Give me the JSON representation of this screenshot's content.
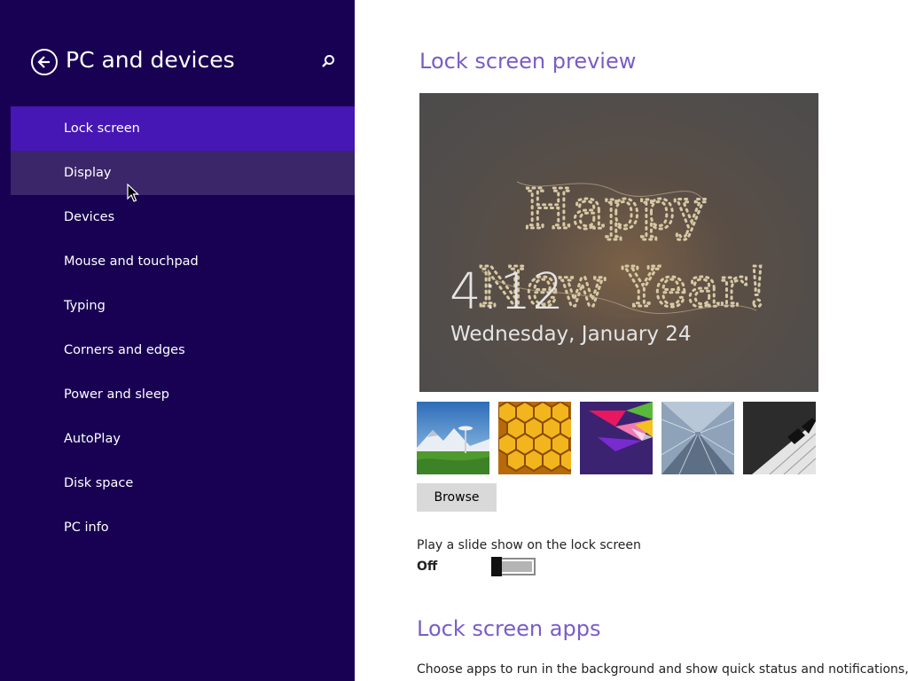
{
  "sidebar": {
    "title": "PC and devices",
    "back_icon": "back-arrow-icon",
    "search_icon": "search-icon",
    "items": [
      {
        "label": "Lock screen",
        "state": "selected"
      },
      {
        "label": "Display",
        "state": "hovered"
      },
      {
        "label": "Devices"
      },
      {
        "label": "Mouse and touchpad"
      },
      {
        "label": "Typing"
      },
      {
        "label": "Corners and edges"
      },
      {
        "label": "Power and sleep"
      },
      {
        "label": "AutoPlay"
      },
      {
        "label": "Disk space"
      },
      {
        "label": "PC info"
      }
    ]
  },
  "content": {
    "preview_heading": "Lock screen preview",
    "preview": {
      "image_text_line1": "Happy",
      "image_text_line2": "New Year!",
      "time": "4:12",
      "date": "Wednesday, January 24"
    },
    "thumbnails": [
      "space-needle-image",
      "honeycomb-image",
      "colorful-shapes-image",
      "moving-walkway-image",
      "piano-keys-image"
    ],
    "browse_label": "Browse",
    "slideshow": {
      "label": "Play a slide show on the lock screen",
      "state": "Off"
    },
    "apps_heading": "Lock screen apps",
    "apps_description": "Choose apps to run in the background and show quick status and notifications,"
  },
  "colors": {
    "sidebar_bg": "#180052",
    "selected_item": "#4617b4",
    "hovered_item": "#3a2668",
    "heading_accent": "#7a5cc7"
  }
}
